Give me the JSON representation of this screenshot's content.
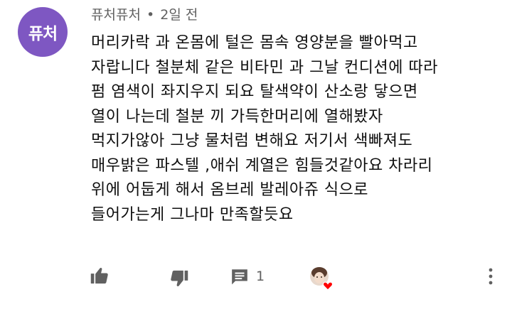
{
  "comment": {
    "avatar_text": "퓨처",
    "author": "퓨처퓨처",
    "separator": "•",
    "time": "2일 전",
    "lines": [
      "머리카락 과 온몸에 털은 몸속 영양분을 빨아먹고",
      "자랍니다  철분체 같은 비타민 과 그날 컨디션에 따라",
      "펌 염색이 좌지우지 되요 탈색약이 산소랑 닿으면",
      "열이 나는데 철분 끼 가득한머리에 열해봤자",
      "먹지가않아 그냥 물처럼 변해요 저기서 색빠져도",
      "매우밝은 파스텔 ,애쉬 계열은 힘들것같아요 차라리",
      "위에 어둡게 해서 옴브레 발레아쥬 식으로",
      "들어가는게 그나마 만족할듯요"
    ]
  },
  "actions": {
    "like_icon": "thumbs-up-icon",
    "dislike_icon": "thumbs-down-icon",
    "reply_icon": "comment-icon",
    "reply_count": "1",
    "creator_heart_icon": "creator-heart-icon",
    "more_icon": "more-vert-icon"
  },
  "colors": {
    "avatar_bg": "#7e57c2",
    "heart": "#ff0000",
    "icon": "#606060",
    "meta_text": "#606060"
  }
}
